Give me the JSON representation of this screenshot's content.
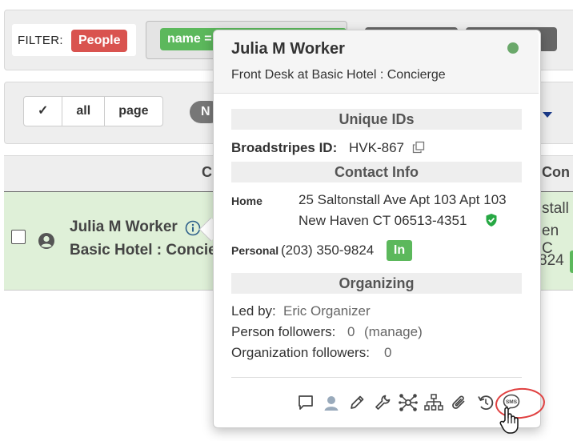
{
  "filter": {
    "label": "FILTER:",
    "chip_type": "People",
    "chip_name": "name ="
  },
  "actions": {
    "check_symbol": "✓",
    "all_label": "all",
    "page_label": "page",
    "pill_text": "N"
  },
  "table": {
    "col_c1": "C",
    "col_c2": "Con"
  },
  "row": {
    "name": "Julia M Worker",
    "org": "Basic Hotel : Concie",
    "right_line1": "stall",
    "right_line2": "en C",
    "right_line3": "824"
  },
  "popover": {
    "name": "Julia M Worker",
    "subtitle": "Front Desk at Basic Hotel : Concierge",
    "unique_ids_heading": "Unique IDs",
    "broadstripes_label": "Broadstripes ID:",
    "broadstripes_value": "HVK-867",
    "contact_heading": "Contact Info",
    "home_label": "Home",
    "home_line1": "25 Saltonstall Ave Apt 103 Apt 103",
    "home_line2": "New Haven CT 06513-4351",
    "personal_label": "Personal",
    "personal_phone": "(203) 350-9824",
    "in_badge": "In",
    "organizing_heading": "Organizing",
    "led_by_label": "Led by:",
    "led_by_value": "Eric Organizer",
    "person_followers_label": "Person followers:",
    "person_followers_value": "0",
    "manage_link": "(manage)",
    "org_followers_label": "Organization followers:",
    "org_followers_value": "0",
    "sms_label": "SMS"
  },
  "colors": {
    "accent_green": "#5cb85c",
    "accent_red": "#d9534f",
    "row_highlight": "#dff0d8",
    "status_online": "#6aa86a",
    "annotation_red": "#e04040"
  },
  "icons": [
    "comment-icon",
    "user-icon",
    "pencil-icon",
    "wrench-icon",
    "network-icon",
    "org-chart-icon",
    "paperclip-icon",
    "history-icon",
    "sms-icon",
    "copy-icon",
    "verified-icon",
    "info-icon",
    "hand-cursor-icon"
  ]
}
